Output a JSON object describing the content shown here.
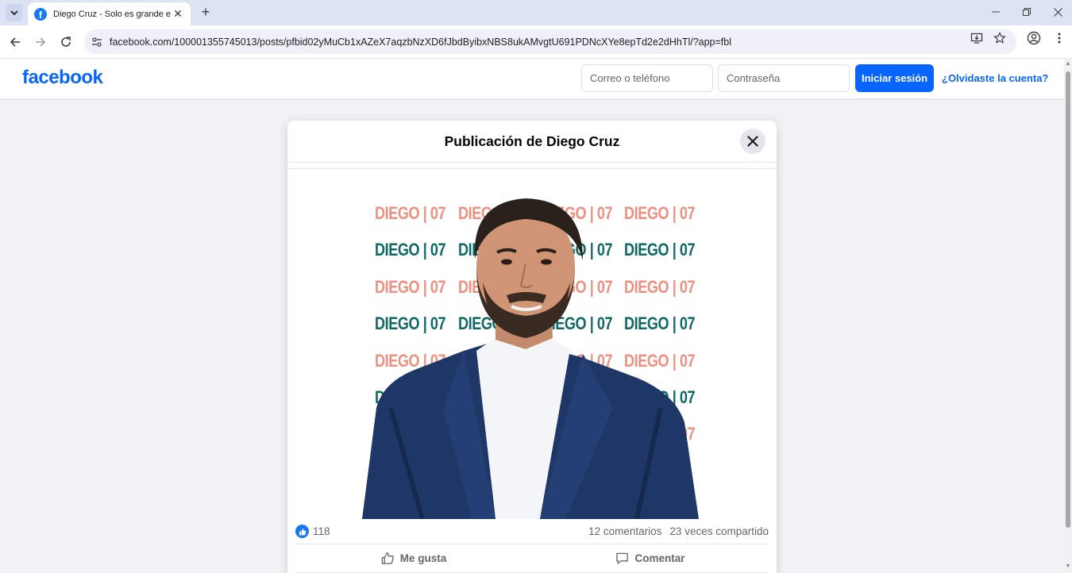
{
  "browser": {
    "tab_title": "Diego Cruz - Solo es grande en",
    "url": "facebook.com/100001355745013/posts/pfbid02yMuCb1xAZeX7aqzbNzXD6fJbdByibxNBS8ukAMvgtU691PDNcXYe8epTd2e2dHhTl/?app=fbl"
  },
  "header": {
    "logo": "facebook",
    "email_placeholder": "Correo o teléfono",
    "password_placeholder": "Contraseña",
    "login_label": "Iniciar sesión",
    "forgot_label": "¿Olvidaste la cuenta?"
  },
  "post": {
    "title": "Publicación de Diego Cruz",
    "image_brand_text": "DIEGO | 07",
    "reactions_count": "118",
    "comments_count": "12 comentarios",
    "shares_count": "23 veces compartido",
    "like_label": "Me gusta",
    "comment_label": "Comentar"
  },
  "colors": {
    "facebook_blue": "#0866ff",
    "brand_pink": "#ef8f80",
    "brand_teal": "#0e6a63",
    "page_background": "#f0f2f5"
  }
}
